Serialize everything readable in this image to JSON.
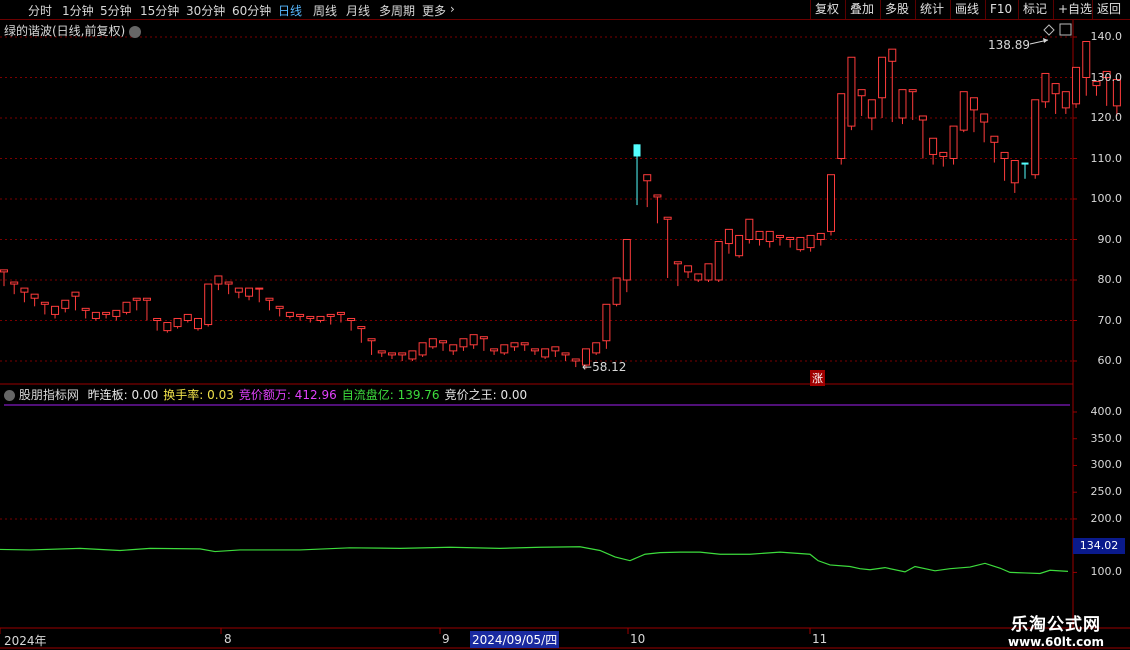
{
  "toolbar": {
    "periods": [
      "分时",
      "1分钟",
      "5分钟",
      "15分钟",
      "30分钟",
      "60分钟",
      "日线",
      "周线",
      "月线",
      "多周期",
      "更多"
    ],
    "active_period": "日线",
    "more_arrow": "›",
    "right_buttons": [
      "复权",
      "叠加",
      "多股",
      "统计",
      "画线",
      "F10",
      "标记",
      "+自选",
      "返回"
    ]
  },
  "main": {
    "title": "绿的谐波(日线,前复权)",
    "high_label": "138.89",
    "low_label": "58.12",
    "zhang_badge": "涨",
    "y_ticks": [
      "140.0",
      "130.0",
      "120.0",
      "110.0",
      "100.0",
      "90.0",
      "80.0",
      "70.0",
      "60.0"
    ]
  },
  "indicator": {
    "name": "股朋指标网",
    "fields": [
      {
        "label": "昨连板:",
        "value": "0.00",
        "color": "#e6e6e6"
      },
      {
        "label": "换手率:",
        "value": "0.03",
        "color": "#f0e14a"
      },
      {
        "label": "竞价额万:",
        "value": "412.96",
        "color": "#e040fb"
      },
      {
        "label": "自流盘亿:",
        "value": "139.76",
        "color": "#3ddc3d"
      },
      {
        "label": "竞价之王:",
        "value": "0.00",
        "color": "#e6e6e6"
      }
    ],
    "y_ticks": [
      "400.0",
      "350.0",
      "300.0",
      "250.0",
      "200.0",
      "150.0",
      "100.0"
    ],
    "current_value": "134.02"
  },
  "date_axis": {
    "year": "2024年",
    "months": [
      "8",
      "9",
      "10",
      "11"
    ],
    "cursor_date": "2024/09/05/四"
  },
  "watermark": {
    "name": "乐淘公式网",
    "url": "www.60lt.com"
  },
  "colors": {
    "up": "#ff3c3c",
    "down": "#54ffff",
    "grid": "#7a0000",
    "line": "#3ddc3d",
    "purple": "#a020f0"
  },
  "chart_data": {
    "type": "candlestick",
    "y_range": [
      55,
      143
    ],
    "candles": [
      [
        82,
        82.5,
        78.5,
        79
      ],
      [
        79,
        79.5,
        76.5,
        77
      ],
      [
        77,
        78,
        74.5,
        75.5
      ],
      [
        75.5,
        76.5,
        73.5,
        74.5
      ],
      [
        74,
        74.5,
        71.5,
        72.5
      ],
      [
        71.5,
        73.5,
        70.5,
        73
      ],
      [
        73,
        75,
        72,
        74.5
      ],
      [
        76,
        77,
        72.5,
        73
      ],
      [
        72.5,
        73,
        70.5,
        71
      ],
      [
        70.5,
        72,
        70,
        71.5
      ],
      [
        71.5,
        72,
        70.5,
        71
      ],
      [
        71,
        72.5,
        70,
        72
      ],
      [
        72,
        74.5,
        71.5,
        74
      ],
      [
        75,
        75.5,
        72.5,
        73
      ],
      [
        75,
        75.5,
        70,
        70.5
      ],
      [
        70,
        70.5,
        67.5,
        68
      ],
      [
        67.5,
        69.5,
        67,
        69
      ],
      [
        68.5,
        70.5,
        68,
        70
      ],
      [
        70,
        71.5,
        69.5,
        70.5
      ],
      [
        68,
        70.5,
        67.5,
        70
      ],
      [
        69,
        79,
        68.5,
        78
      ],
      [
        79,
        81,
        77.5,
        80
      ],
      [
        79,
        79.5,
        76.5,
        77
      ],
      [
        77,
        78,
        75.5,
        76
      ],
      [
        76,
        78,
        75,
        77
      ],
      [
        78,
        78,
        74.5,
        75
      ],
      [
        75,
        75.5,
        72.5,
        73
      ],
      [
        73,
        73.5,
        71,
        71.5
      ],
      [
        71,
        72,
        70.5,
        71
      ],
      [
        71,
        71.5,
        70,
        70.5
      ],
      [
        70.5,
        71,
        69.5,
        70
      ],
      [
        70,
        71,
        69.5,
        70.5
      ],
      [
        71,
        71.5,
        69,
        69.5
      ],
      [
        71.5,
        72,
        69.5,
        70
      ],
      [
        70,
        70.5,
        67.5,
        68
      ],
      [
        68,
        68.5,
        64.5,
        65
      ],
      [
        65,
        65.5,
        61.5,
        62
      ],
      [
        62,
        62.5,
        61,
        61.5
      ],
      [
        61.5,
        62,
        60.5,
        61
      ],
      [
        61.5,
        62,
        60,
        60.5
      ],
      [
        60.5,
        62.5,
        60,
        62
      ],
      [
        61.5,
        64.5,
        61,
        64
      ],
      [
        63.5,
        65.5,
        63,
        65
      ],
      [
        64.5,
        65,
        62.5,
        63
      ],
      [
        62.5,
        64,
        61.5,
        63.5
      ],
      [
        63.5,
        65.5,
        62.5,
        64.5
      ],
      [
        64,
        66.5,
        63,
        65.5
      ],
      [
        65.5,
        66,
        62.5,
        63
      ],
      [
        62.5,
        63,
        61.5,
        62
      ],
      [
        62,
        64,
        61.5,
        63.5
      ],
      [
        63.5,
        64.5,
        62.5,
        64
      ],
      [
        64,
        64.5,
        62.5,
        63
      ],
      [
        62.5,
        63,
        61.5,
        62
      ],
      [
        61,
        63,
        60.5,
        62.5
      ],
      [
        62.5,
        63.5,
        61,
        61.5
      ],
      [
        61.5,
        62,
        60,
        60.5
      ],
      [
        60,
        60.5,
        58.5,
        59
      ],
      [
        59,
        63,
        58.12,
        62.5
      ],
      [
        62,
        64.5,
        61.5,
        64
      ],
      [
        65,
        74,
        63,
        73.5
      ],
      [
        74,
        80.5,
        73.5,
        79.5
      ],
      [
        80,
        90,
        77,
        89
      ],
      [
        113.5,
        110.5,
        98.5,
        110.5
      ],
      [
        104.5,
        106,
        98,
        101
      ],
      [
        100.5,
        101,
        94,
        95
      ],
      [
        95,
        95.5,
        80.5,
        84
      ],
      [
        84,
        84.5,
        78.5,
        83
      ],
      [
        82,
        83.5,
        80.5,
        81.5
      ],
      [
        80,
        81.5,
        79.5,
        81
      ],
      [
        80,
        84,
        79.5,
        83
      ],
      [
        80,
        89.5,
        79.5,
        88.5
      ],
      [
        89,
        92.5,
        86.5,
        87.5
      ],
      [
        86,
        91,
        85.5,
        89.5
      ],
      [
        90,
        95,
        89,
        91
      ],
      [
        90,
        92,
        88.5,
        89.5
      ],
      [
        89.5,
        92,
        88,
        91
      ],
      [
        90.5,
        91,
        88.5,
        89.5
      ],
      [
        90,
        90.5,
        88,
        88.5
      ],
      [
        87.5,
        90.5,
        87,
        90
      ],
      [
        88,
        91,
        87,
        90.5
      ],
      [
        90,
        91.5,
        88.5,
        89
      ],
      [
        92,
        106,
        91,
        105.5
      ],
      [
        110,
        126,
        108.5,
        118.5
      ],
      [
        118,
        135,
        117,
        125.5
      ],
      [
        125.5,
        127,
        120.5,
        121.5
      ],
      [
        120,
        124.5,
        117,
        122.5
      ],
      [
        125,
        135,
        120,
        132
      ],
      [
        134,
        137,
        120,
        119
      ],
      [
        120,
        127,
        118.5,
        126
      ],
      [
        126.5,
        127,
        119.5,
        120
      ],
      [
        119.5,
        120.5,
        110,
        111
      ],
      [
        111,
        115,
        108.5,
        109
      ],
      [
        110.5,
        111.5,
        108,
        109.5
      ],
      [
        110,
        118,
        108.5,
        116.5
      ],
      [
        117,
        126.5,
        116.5,
        122.5
      ],
      [
        122,
        125,
        116.5,
        119
      ],
      [
        119,
        121,
        114,
        115
      ],
      [
        114,
        115.5,
        109,
        111
      ],
      [
        110,
        111.5,
        104.5,
        106
      ],
      [
        104,
        109.5,
        101.5,
        108
      ],
      [
        109,
        108.5,
        105,
        106.5
      ],
      [
        106,
        124.5,
        105,
        124
      ],
      [
        124,
        131,
        122.5,
        126
      ],
      [
        126,
        128.5,
        121,
        123
      ],
      [
        122.5,
        126.5,
        121,
        125
      ],
      [
        123.5,
        132.5,
        122.5,
        130
      ],
      [
        130,
        138.89,
        125.5,
        128
      ],
      [
        128,
        129,
        125.5,
        126
      ],
      [
        130,
        131.5,
        123,
        123.5
      ],
      [
        123,
        129.5,
        120.5,
        122.5
      ]
    ],
    "indicator_line": [
      [
        0,
        143
      ],
      [
        30,
        142
      ],
      [
        80,
        145
      ],
      [
        120,
        141
      ],
      [
        150,
        145
      ],
      [
        200,
        144
      ],
      [
        215,
        139
      ],
      [
        240,
        142
      ],
      [
        300,
        142
      ],
      [
        350,
        146
      ],
      [
        400,
        145
      ],
      [
        450,
        147
      ],
      [
        500,
        145
      ],
      [
        540,
        147
      ],
      [
        580,
        148
      ],
      [
        600,
        141
      ],
      [
        615,
        129
      ],
      [
        630,
        122
      ],
      [
        645,
        134
      ],
      [
        660,
        137
      ],
      [
        680,
        138
      ],
      [
        700,
        138
      ],
      [
        720,
        134
      ],
      [
        750,
        134
      ],
      [
        780,
        138
      ],
      [
        810,
        134
      ],
      [
        818,
        122
      ],
      [
        830,
        114
      ],
      [
        850,
        111
      ],
      [
        860,
        107
      ],
      [
        870,
        105
      ],
      [
        885,
        109
      ],
      [
        905,
        101
      ],
      [
        915,
        111
      ],
      [
        935,
        103
      ],
      [
        950,
        107
      ],
      [
        970,
        110
      ],
      [
        985,
        117
      ],
      [
        1000,
        108
      ],
      [
        1010,
        100
      ],
      [
        1025,
        99
      ],
      [
        1040,
        98
      ],
      [
        1050,
        104
      ],
      [
        1068,
        102
      ]
    ]
  }
}
